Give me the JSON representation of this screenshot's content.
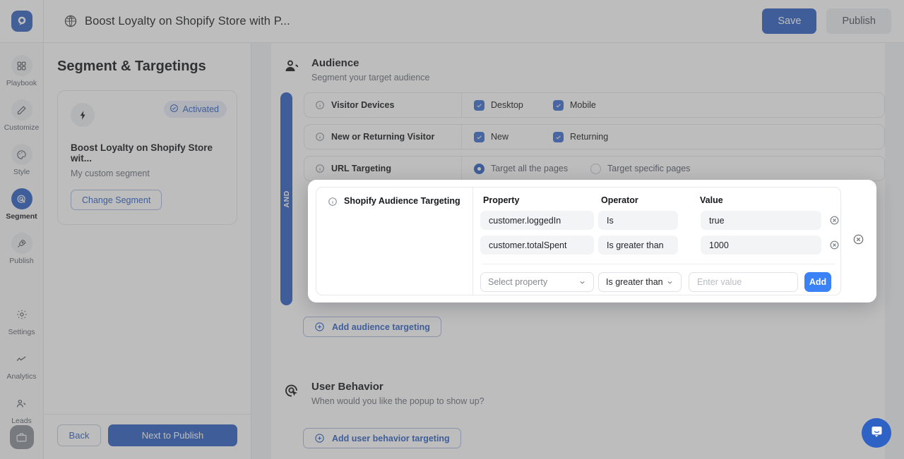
{
  "topbar": {
    "logo_icon": "logo-mark",
    "globe_icon": "globe-icon",
    "doc_title": "Boost Loyalty on Shopify Store with P...",
    "save_label": "Save",
    "publish_label": "Publish"
  },
  "rail": {
    "items": [
      {
        "label": "Playbook",
        "icon": "grid-icon",
        "active": false
      },
      {
        "label": "Customize",
        "icon": "pencil-icon",
        "active": false
      },
      {
        "label": "Style",
        "icon": "palette-icon",
        "active": false
      },
      {
        "label": "Segment",
        "icon": "target-icon",
        "active": true
      },
      {
        "label": "Publish",
        "icon": "rocket-icon",
        "active": false
      },
      {
        "label": "Settings",
        "icon": "gear-icon",
        "active": false
      },
      {
        "label": "Analytics",
        "icon": "chart-line-icon",
        "active": false
      },
      {
        "label": "Leads",
        "icon": "users-icon",
        "active": false
      }
    ],
    "avatar_icon": "briefcase-icon"
  },
  "left_panel": {
    "title": "Segment & Targetings",
    "badge": "Activated",
    "badge_icon": "check-circle-icon",
    "card_icon": "bolt-icon",
    "segment_name": "Boost Loyalty on Shopify Store wit...",
    "segment_sub": "My custom segment",
    "change_segment_label": "Change Segment",
    "back_label": "Back",
    "next_label": "Next to Publish"
  },
  "audience": {
    "icon": "audience-icon",
    "title": "Audience",
    "subtitle": "Segment your target audience",
    "and_label": "AND",
    "rules": [
      {
        "label": "Visitor Devices",
        "type": "checkbox",
        "options": [
          {
            "label": "Desktop",
            "checked": true
          },
          {
            "label": "Mobile",
            "checked": true
          }
        ]
      },
      {
        "label": "New or Returning Visitor",
        "type": "checkbox",
        "options": [
          {
            "label": "New",
            "checked": true
          },
          {
            "label": "Returning",
            "checked": true
          }
        ]
      },
      {
        "label": "URL Targeting",
        "type": "radio",
        "options": [
          {
            "label": "Target all the pages",
            "checked": true
          },
          {
            "label": "Target specific pages",
            "checked": false
          }
        ]
      }
    ],
    "add_label": "Add audience targeting",
    "add_icon": "plus-circle-icon"
  },
  "shopify_modal": {
    "info_icon": "info-icon",
    "title": "Shopify Audience Targeting",
    "columns": {
      "property": "Property",
      "operator": "Operator",
      "value": "Value"
    },
    "conditions": [
      {
        "property": "customer.loggedIn",
        "operator": "Is",
        "value": "true",
        "remove_icon": "remove-circle-icon"
      },
      {
        "property": "customer.totalSpent",
        "operator": "Is greater than",
        "value": "1000",
        "remove_icon": "remove-circle-icon"
      }
    ],
    "new_row": {
      "property_placeholder": "Select property",
      "operator_value": "Is greater than",
      "value_placeholder": "Enter value",
      "add_label": "Add",
      "chevron_icon": "chevron-down-icon"
    },
    "close_icon": "remove-circle-icon"
  },
  "user_behavior": {
    "icon": "cursor-target-icon",
    "title": "User Behavior",
    "subtitle": "When would you like the popup to show up?",
    "add_label": "Add user behavior targeting",
    "add_icon": "plus-circle-icon"
  },
  "chat": {
    "icon": "chat-bubble-icon"
  },
  "colors": {
    "accent": "#2e62c4",
    "accent_bright": "#3b82f6",
    "badge_bg": "#e8edf9",
    "panel_bg": "#ffffff",
    "rail_bg": "#fafbfc"
  }
}
